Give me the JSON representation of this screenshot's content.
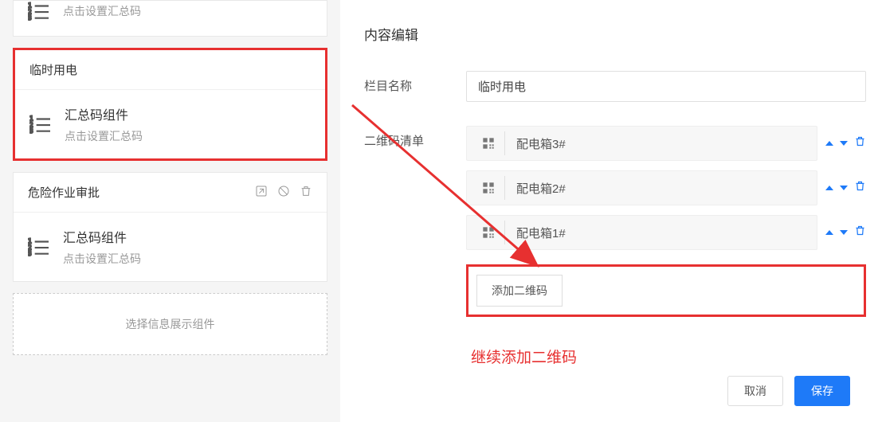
{
  "left": {
    "partial_component_subtitle": "点击设置汇总码",
    "highlighted_card": {
      "title": "临时用电",
      "component_title": "汇总码组件",
      "component_subtitle": "点击设置汇总码"
    },
    "danger_card": {
      "title": "危险作业审批",
      "component_title": "汇总码组件",
      "component_subtitle": "点击设置汇总码"
    },
    "placeholder": "选择信息展示组件"
  },
  "right": {
    "title": "内容编辑",
    "column_label": "栏目名称",
    "column_value": "临时用电",
    "qr_label": "二维码清单",
    "qr_items": [
      "配电箱3#",
      "配电箱2#",
      "配电箱1#"
    ],
    "add_button": "添加二维码",
    "note": "继续添加二维码",
    "cancel": "取消",
    "save": "保存"
  }
}
